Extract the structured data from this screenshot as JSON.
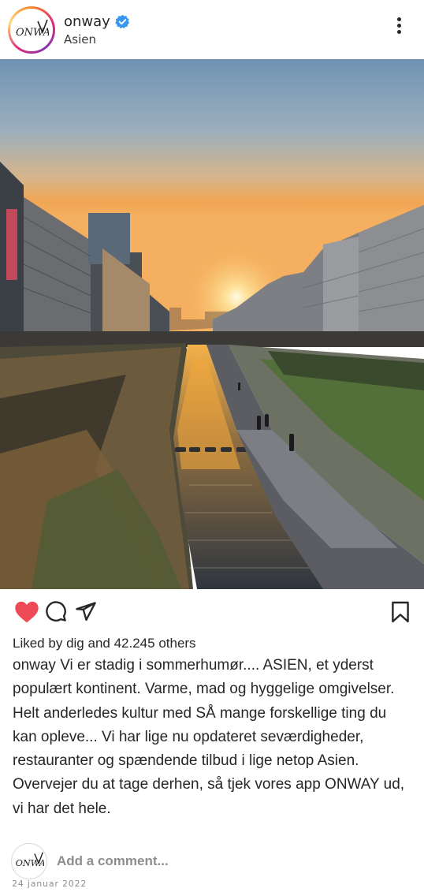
{
  "post": {
    "username": "onway",
    "verified": true,
    "location": "Asien",
    "avatar_text": "ONWAY",
    "liked_by_prefix": "Liked by",
    "liked_by_user": "dig",
    "liked_by_and": "and",
    "liked_by_count": "42.245 others",
    "caption_user": "onway",
    "caption_text": "Vi er stadig i sommerhumør.... ASIEN, et yderst populært kontinent. Varme, mad og hyggelige omgivelser. Helt anderledes kultur med SÅ mange forskellige ting du kan opleve... Vi har lige nu opdateret seværdigheder, restauranter og spændende tilbud i lige netop Asien. Overvejer du at tage derhen, så tjek vores app ONWAY ud, vi har det hele.",
    "comment_placeholder": "Add a comment...",
    "date": "24 januar 2022"
  },
  "icons": {
    "like": "heart-icon",
    "comment": "comment-bubble-icon",
    "share": "paper-plane-icon",
    "save": "bookmark-icon",
    "more": "more-vertical-icon",
    "verified": "verified-badge-icon"
  },
  "colors": {
    "like_red": "#ed4956",
    "verified_blue": "#3897f0",
    "muted_text": "#8e8e8e"
  }
}
